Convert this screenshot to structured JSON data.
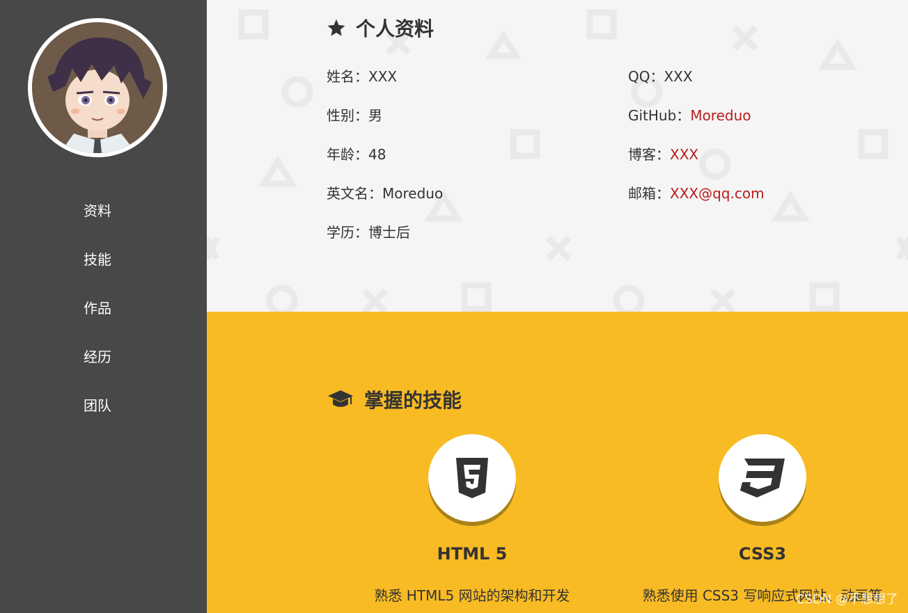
{
  "sidebar": {
    "nav": [
      {
        "label": "资料"
      },
      {
        "label": "技能"
      },
      {
        "label": "作品"
      },
      {
        "label": "经历"
      },
      {
        "label": "团队"
      }
    ]
  },
  "profile": {
    "title": "个人资料",
    "title_icon": "star-icon",
    "left": [
      {
        "label": "姓名：",
        "value": "XXX"
      },
      {
        "label": "性别：",
        "value": "男"
      },
      {
        "label": "年龄：",
        "value": "48"
      },
      {
        "label": "英文名：",
        "value": "Moreduo"
      },
      {
        "label": "学历：",
        "value": "博士后"
      }
    ],
    "right": [
      {
        "label": "QQ：",
        "value": "XXX"
      },
      {
        "label": "GitHub：",
        "value": "Moreduo"
      },
      {
        "label": "博客：",
        "value": "XXX"
      },
      {
        "label": "邮箱：",
        "value": "XXX@qq.com"
      }
    ]
  },
  "skills": {
    "title": "掌握的技能",
    "title_icon": "graduation-cap-icon",
    "items": [
      {
        "icon": "html5-icon",
        "name": "HTML 5",
        "desc": "熟悉 HTML5 网站的架构和开发"
      },
      {
        "icon": "css3-icon",
        "name": "CSS3",
        "desc": "熟悉使用 CSS3 写响应式网站、动画等"
      }
    ]
  },
  "watermark": "CSDN @不想想了",
  "colors": {
    "sidebar_bg": "#484848",
    "profile_bg": "#f5f5f5",
    "skills_bg": "#f8bb24",
    "link": "#b81c1c",
    "text": "#333333"
  }
}
